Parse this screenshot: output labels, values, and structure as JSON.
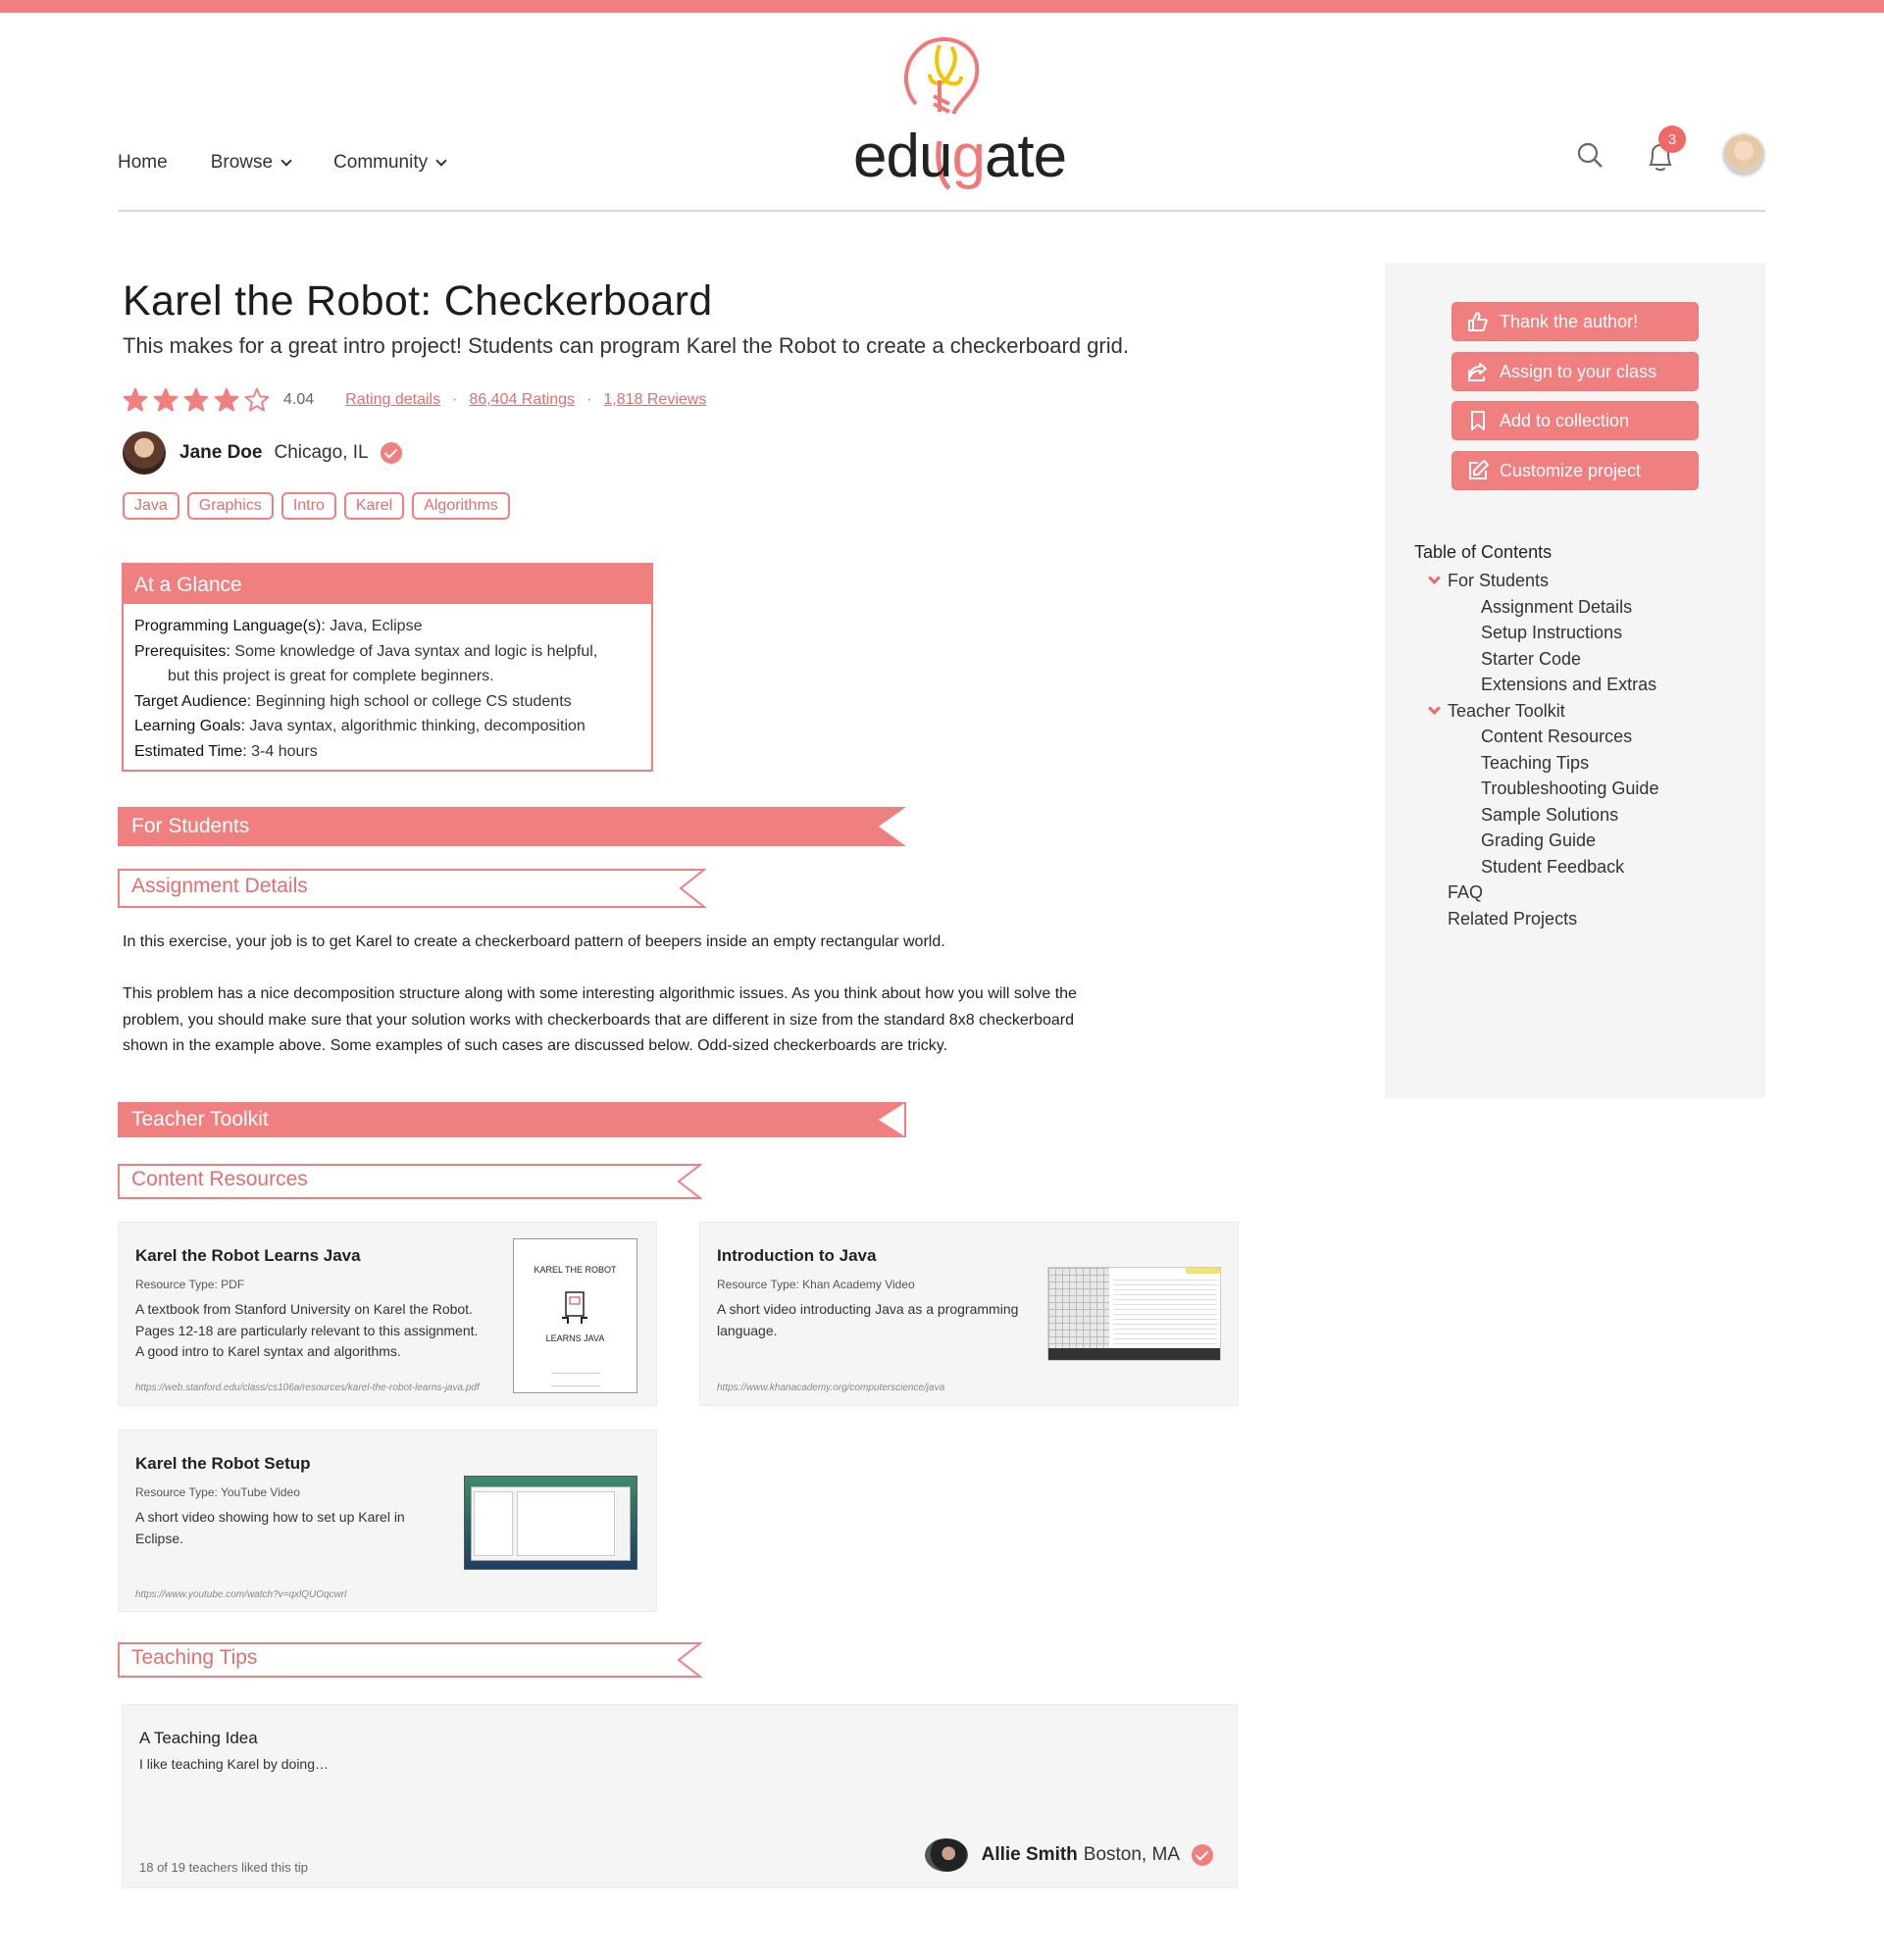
{
  "brand": {
    "name": "edugate",
    "accent": "#f08080"
  },
  "nav": {
    "home": "Home",
    "browse": "Browse",
    "community": "Community"
  },
  "header": {
    "notifications_count": "3"
  },
  "project": {
    "title": "Karel the Robot: Checkerboard",
    "subtitle": "This makes for a great intro project! Students can program Karel the Robot to create a checkerboard grid.",
    "rating_value": "4.04",
    "rating_stars": 4,
    "rating_details": "Rating details",
    "ratings_count": "86,404 Ratings",
    "reviews_count": "1,818 Reviews",
    "author": {
      "name": "Jane Doe",
      "location": "Chicago, IL"
    },
    "tags": [
      "Java",
      "Graphics",
      "Intro",
      "Karel",
      "Algorithms"
    ]
  },
  "glance": {
    "heading": "At a Glance",
    "language_label": "Programming Language(s):",
    "language_value": " Java, Eclipse",
    "prereq_label": "Prerequisites:",
    "prereq_value": " Some knowledge of Java syntax and logic is helpful,",
    "prereq_value2": "but this project is great for complete beginners.",
    "audience_label": "Target Audience:",
    "audience_value": " Beginning high school or college CS students",
    "goals_label": "Learning Goals:",
    "goals_value": " Java syntax, algorithmic thinking, decomposition",
    "time_label": "Estimated Time:",
    "time_value": " 3-4 hours"
  },
  "sections": {
    "for_students": "For Students",
    "assignment_details": "Assignment Details",
    "teacher_toolkit": "Teacher Toolkit",
    "content_resources": "Content Resources",
    "teaching_tips": "Teaching Tips"
  },
  "assignment": {
    "p1": "In this exercise, your job is to get Karel to create a checkerboard pattern of beepers inside an empty rectangular world.",
    "p2_l1": "This problem has a nice decomposition structure along with some interesting algorithmic issues. As you think about how you will solve the",
    "p2_l2": "problem, you should make sure that your solution works with checkerboards that are different in size from the standard 8x8 checkerboard",
    "p2_l3": "shown in the example above. Some examples of such cases are discussed below. Odd-sized checkerboards are tricky."
  },
  "resources": [
    {
      "title": "Karel the Robot Learns Java",
      "type": "Resource Type: PDF",
      "desc1": "A textbook from Stanford University on Karel the Robot.",
      "desc2": "Pages 12-18 are particularly relevant to this assignment.",
      "desc3": "A good intro to Karel syntax and algorithms.",
      "url": "https://web.stanford.edu/class/cs106a/resources/karel-the-robot-learns-java.pdf",
      "thumb_title": "KAREL THE ROBOT",
      "thumb_sub": "LEARNS JAVA"
    },
    {
      "title": "Introduction to Java",
      "type": "Resource Type: Khan Academy Video",
      "desc1": "A short video introducting Java as a programming",
      "desc2": "language.",
      "url": "https://www.khanacademy.org/computerscience/java"
    },
    {
      "title": "Karel the Robot Setup",
      "type": "Resource Type: YouTube Video",
      "desc1": "A short video showing how to set up Karel in",
      "desc2": "Eclipse.",
      "url": "https://www.youtube.com/watch?v=qxlQUOqcwrl"
    }
  ],
  "tip": {
    "title": "A Teaching Idea",
    "body": "I like teaching Karel by doing…",
    "likes": "18 of 19 teachers liked this tip",
    "author_name": "Allie Smith",
    "author_location": "Boston, MA"
  },
  "sidebar": {
    "buttons": [
      "Thank the author!",
      "Assign to your class",
      "Add to collection",
      "Customize project"
    ],
    "toc_title": "Table of Contents",
    "toc": {
      "for_students": "For Students",
      "assignment_details": "Assignment Details",
      "setup_instructions": "Setup Instructions",
      "starter_code": "Starter Code",
      "extensions": "Extensions and Extras",
      "teacher_toolkit": "Teacher Toolkit",
      "content_resources": "Content Resources",
      "teaching_tips": "Teaching Tips",
      "troubleshooting": "Troubleshooting Guide",
      "sample_solutions": "Sample Solutions",
      "grading_guide": "Grading Guide",
      "student_feedback": "Student Feedback",
      "faq": "FAQ",
      "related_projects": "Related Projects"
    }
  }
}
